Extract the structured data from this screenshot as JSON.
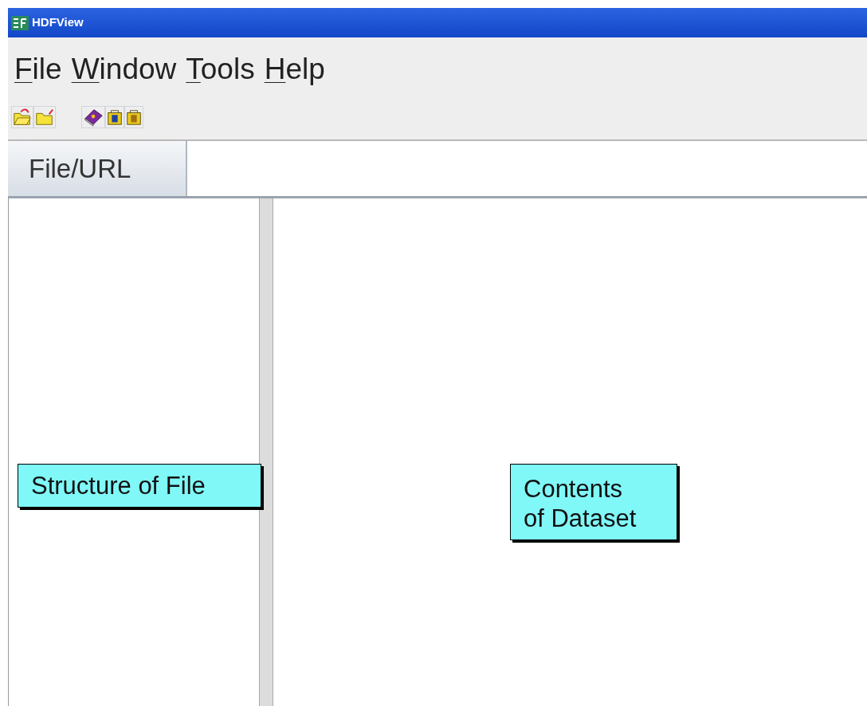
{
  "window": {
    "title": "HDFView"
  },
  "menu": [
    {
      "label": "File",
      "mnemonic_underlined": true
    },
    {
      "label": "Window",
      "mnemonic_underlined": true
    },
    {
      "label": "Tools",
      "mnemonic_underlined": true
    },
    {
      "label": "Help",
      "mnemonic_underlined": true
    }
  ],
  "url_bar": {
    "label": "File/URL"
  },
  "callouts": [
    {
      "text": "Structure of File",
      "kind": "tree"
    },
    {
      "text": "Contents of Dataset",
      "kind": "content"
    }
  ]
}
